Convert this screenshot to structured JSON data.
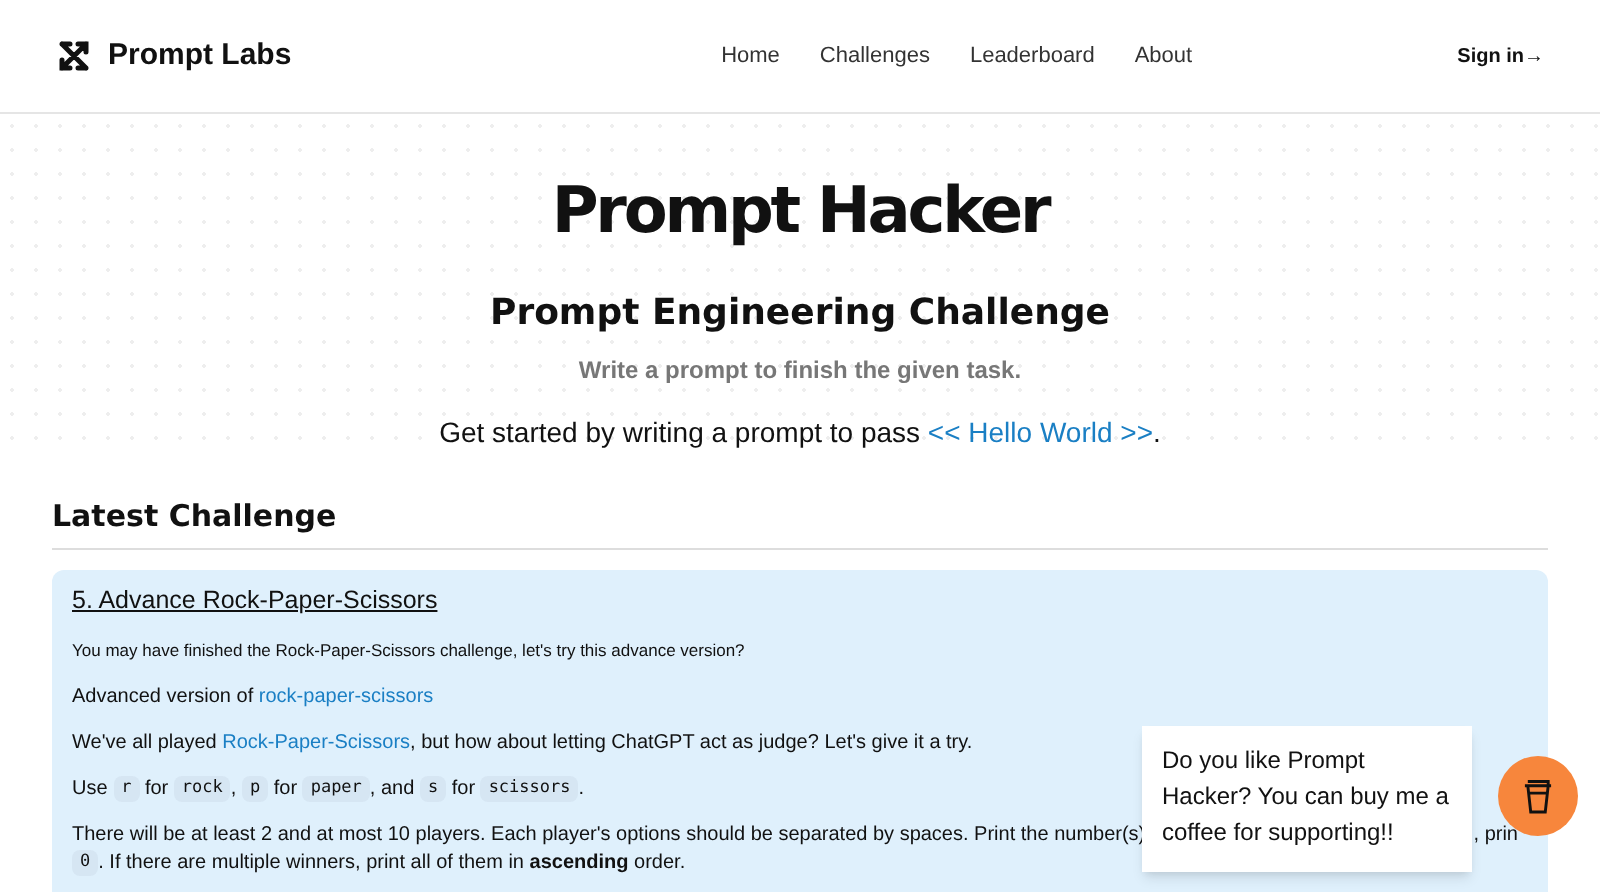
{
  "brand": {
    "name": "Prompt Labs"
  },
  "nav": [
    {
      "label": "Home"
    },
    {
      "label": "Challenges"
    },
    {
      "label": "Leaderboard"
    },
    {
      "label": "About"
    }
  ],
  "sign_in": "Sign in→",
  "hero": {
    "title": "Prompt Hacker",
    "subtitle": "Prompt Engineering Challenge",
    "tagline": "Write a prompt to finish the given task.",
    "start_text": "Get started by writing a prompt to pass",
    "start_link": "<< Hello World >>",
    "start_end": "."
  },
  "section_title": "Latest Challenge",
  "challenge": {
    "title": "5. Advance Rock-Paper-Scissors",
    "intro": "You may have finished the Rock-Paper-Scissors challenge, let's try this advance version?",
    "advanced_text": "Advanced version of",
    "advanced_link": "rock-paper-scissors",
    "played_before": "We've all played",
    "played_link": "Rock-Paper-Scissors",
    "played_after": ", but how about letting ChatGPT act as judge? Let's give it a try.",
    "use_line": [
      {
        "kind": "text",
        "text": "Use "
      },
      {
        "kind": "code",
        "text": "r"
      },
      {
        "kind": "text",
        "text": " for "
      },
      {
        "kind": "code",
        "text": "rock"
      },
      {
        "kind": "text",
        "text": ", "
      },
      {
        "kind": "code",
        "text": "p"
      },
      {
        "kind": "text",
        "text": " for "
      },
      {
        "kind": "code",
        "text": "paper"
      },
      {
        "kind": "text",
        "text": ", and "
      },
      {
        "kind": "code",
        "text": "s"
      },
      {
        "kind": "text",
        "text": " for "
      },
      {
        "kind": "code",
        "text": "scissors"
      },
      {
        "kind": "text",
        "text": "."
      }
    ],
    "rules_line_start": "There will be at least 2 and at most 10 players. Each player's options should be separated by spaces. Print the number(s)",
    "rules_line_end": ", prin",
    "rules_line2": [
      {
        "kind": "code",
        "text": "0"
      },
      {
        "kind": "text",
        "text": ". If there are multiple winners, print all of them in **ascending** order."
      }
    ]
  },
  "popup": {
    "text": "Do you like Prompt Hacker? You can buy me a coffee for supporting!!"
  }
}
